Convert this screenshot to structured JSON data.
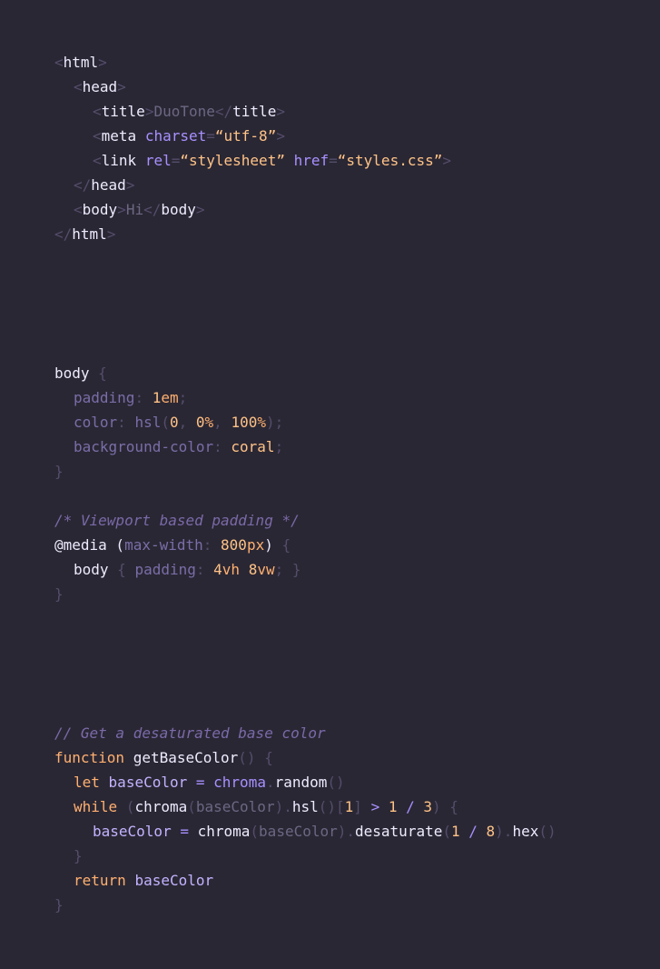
{
  "theme": {
    "background": "#2a2734",
    "colors": {
      "punct": "#544d6b",
      "tag": "#eeebff",
      "attr": "#a890ff",
      "string": "#ffc387",
      "text": "#6c6783",
      "prop": "#7a6ea8",
      "value": "#ffbf87",
      "comment": "#7a6aa8",
      "keyword": "#ffb070",
      "ident": "#eeebff",
      "var": "#c3b3ff"
    }
  },
  "code": {
    "html": [
      {
        "indent": 0,
        "segments": [
          {
            "t": "<",
            "c": "punct"
          },
          {
            "t": "html",
            "c": "tag"
          },
          {
            "t": ">",
            "c": "punct"
          }
        ]
      },
      {
        "indent": 1,
        "segments": [
          {
            "t": "<",
            "c": "punct"
          },
          {
            "t": "head",
            "c": "tag"
          },
          {
            "t": ">",
            "c": "punct"
          }
        ]
      },
      {
        "indent": 2,
        "segments": [
          {
            "t": "<",
            "c": "punct"
          },
          {
            "t": "title",
            "c": "tag"
          },
          {
            "t": ">",
            "c": "punct"
          },
          {
            "t": "DuoTone",
            "c": "text"
          },
          {
            "t": "</",
            "c": "punct"
          },
          {
            "t": "title",
            "c": "tag"
          },
          {
            "t": ">",
            "c": "punct"
          }
        ]
      },
      {
        "indent": 2,
        "segments": [
          {
            "t": "<",
            "c": "punct"
          },
          {
            "t": "meta",
            "c": "tag"
          },
          {
            "t": " ",
            "c": "punct"
          },
          {
            "t": "charset",
            "c": "attr"
          },
          {
            "t": "=",
            "c": "punct"
          },
          {
            "t": "“utf-8”",
            "c": "string"
          },
          {
            "t": ">",
            "c": "punct"
          }
        ]
      },
      {
        "indent": 2,
        "segments": [
          {
            "t": "<",
            "c": "punct"
          },
          {
            "t": "link",
            "c": "tag"
          },
          {
            "t": " ",
            "c": "punct"
          },
          {
            "t": "rel",
            "c": "attr"
          },
          {
            "t": "=",
            "c": "punct"
          },
          {
            "t": "“stylesheet”",
            "c": "string"
          },
          {
            "t": " ",
            "c": "punct"
          },
          {
            "t": "href",
            "c": "attr"
          },
          {
            "t": "=",
            "c": "punct"
          },
          {
            "t": "“styles.css”",
            "c": "string"
          },
          {
            "t": ">",
            "c": "punct"
          }
        ]
      },
      {
        "indent": 1,
        "segments": [
          {
            "t": "</",
            "c": "punct"
          },
          {
            "t": "head",
            "c": "tag"
          },
          {
            "t": ">",
            "c": "punct"
          }
        ]
      },
      {
        "indent": 1,
        "segments": [
          {
            "t": "<",
            "c": "punct"
          },
          {
            "t": "body",
            "c": "tag"
          },
          {
            "t": ">",
            "c": "punct"
          },
          {
            "t": "Hi",
            "c": "text"
          },
          {
            "t": "</",
            "c": "punct"
          },
          {
            "t": "body",
            "c": "tag"
          },
          {
            "t": ">",
            "c": "punct"
          }
        ]
      },
      {
        "indent": 0,
        "segments": [
          {
            "t": "</",
            "c": "punct"
          },
          {
            "t": "html",
            "c": "tag"
          },
          {
            "t": ">",
            "c": "punct"
          }
        ]
      }
    ],
    "css": [
      {
        "indent": 0,
        "segments": [
          {
            "t": "body",
            "c": "tag"
          },
          {
            "t": " {",
            "c": "punct"
          }
        ]
      },
      {
        "indent": 1,
        "segments": [
          {
            "t": "padding",
            "c": "prop"
          },
          {
            "t": ": ",
            "c": "punct"
          },
          {
            "t": "1",
            "c": "string"
          },
          {
            "t": "em",
            "c": "keyword"
          },
          {
            "t": ";",
            "c": "punct"
          }
        ]
      },
      {
        "indent": 1,
        "segments": [
          {
            "t": "color",
            "c": "prop"
          },
          {
            "t": ": ",
            "c": "punct"
          },
          {
            "t": "hsl",
            "c": "prop"
          },
          {
            "t": "(",
            "c": "punct"
          },
          {
            "t": "0",
            "c": "string"
          },
          {
            "t": ", ",
            "c": "punct"
          },
          {
            "t": "0",
            "c": "string"
          },
          {
            "t": "%",
            "c": "keyword"
          },
          {
            "t": ", ",
            "c": "punct"
          },
          {
            "t": "100",
            "c": "string"
          },
          {
            "t": "%",
            "c": "keyword"
          },
          {
            "t": ");",
            "c": "punct"
          }
        ]
      },
      {
        "indent": 1,
        "segments": [
          {
            "t": "background-color",
            "c": "prop"
          },
          {
            "t": ": ",
            "c": "punct"
          },
          {
            "t": "coral",
            "c": "string"
          },
          {
            "t": ";",
            "c": "punct"
          }
        ]
      },
      {
        "indent": 0,
        "segments": [
          {
            "t": "}",
            "c": "punct"
          }
        ]
      },
      {
        "indent": 0,
        "segments": []
      },
      {
        "indent": 0,
        "segments": [
          {
            "t": "/* Viewport based padding */",
            "c": "comment",
            "italic": true
          }
        ]
      },
      {
        "indent": 0,
        "segments": [
          {
            "t": "@media",
            "c": "tag"
          },
          {
            "t": " (",
            "c": "tag"
          },
          {
            "t": "max-width",
            "c": "prop"
          },
          {
            "t": ": ",
            "c": "punct"
          },
          {
            "t": "800",
            "c": "string"
          },
          {
            "t": "px",
            "c": "keyword"
          },
          {
            "t": ")",
            "c": "tag"
          },
          {
            "t": " {",
            "c": "punct"
          }
        ]
      },
      {
        "indent": 1,
        "segments": [
          {
            "t": "body",
            "c": "tag"
          },
          {
            "t": " { ",
            "c": "punct"
          },
          {
            "t": "padding",
            "c": "prop"
          },
          {
            "t": ": ",
            "c": "punct"
          },
          {
            "t": "4",
            "c": "string"
          },
          {
            "t": "vh",
            "c": "keyword"
          },
          {
            "t": " ",
            "c": "punct"
          },
          {
            "t": "8",
            "c": "string"
          },
          {
            "t": "vw",
            "c": "keyword"
          },
          {
            "t": "; }",
            "c": "punct"
          }
        ]
      },
      {
        "indent": 0,
        "segments": [
          {
            "t": "}",
            "c": "punct"
          }
        ]
      }
    ],
    "js": [
      {
        "indent": 0,
        "segments": [
          {
            "t": "// Get a desaturated base color",
            "c": "comment",
            "italic": true
          }
        ]
      },
      {
        "indent": 0,
        "segments": [
          {
            "t": "function",
            "c": "keyword"
          },
          {
            "t": " ",
            "c": "punct"
          },
          {
            "t": "getBaseColor",
            "c": "ident"
          },
          {
            "t": "() {",
            "c": "punct"
          }
        ]
      },
      {
        "indent": 1,
        "segments": [
          {
            "t": "let",
            "c": "keyword"
          },
          {
            "t": " ",
            "c": "punct"
          },
          {
            "t": "baseColor",
            "c": "var"
          },
          {
            "t": " = ",
            "c": "attr"
          },
          {
            "t": "chroma",
            "c": "attr"
          },
          {
            "t": ".",
            "c": "punct"
          },
          {
            "t": "random",
            "c": "ident"
          },
          {
            "t": "()",
            "c": "punct"
          }
        ]
      },
      {
        "indent": 1,
        "segments": [
          {
            "t": "while",
            "c": "keyword"
          },
          {
            "t": " (",
            "c": "punct"
          },
          {
            "t": "chroma",
            "c": "ident"
          },
          {
            "t": "(",
            "c": "punct"
          },
          {
            "t": "baseColor",
            "c": "text"
          },
          {
            "t": ").",
            "c": "punct"
          },
          {
            "t": "hsl",
            "c": "ident"
          },
          {
            "t": "()[",
            "c": "punct"
          },
          {
            "t": "1",
            "c": "string"
          },
          {
            "t": "] ",
            "c": "punct"
          },
          {
            "t": ">",
            "c": "attr"
          },
          {
            "t": " ",
            "c": "punct"
          },
          {
            "t": "1",
            "c": "string"
          },
          {
            "t": " / ",
            "c": "attr"
          },
          {
            "t": "3",
            "c": "string"
          },
          {
            "t": ") {",
            "c": "punct"
          }
        ]
      },
      {
        "indent": 2,
        "segments": [
          {
            "t": "baseColor",
            "c": "var"
          },
          {
            "t": " = ",
            "c": "attr"
          },
          {
            "t": "chroma",
            "c": "ident"
          },
          {
            "t": "(",
            "c": "punct"
          },
          {
            "t": "baseColor",
            "c": "text"
          },
          {
            "t": ").",
            "c": "punct"
          },
          {
            "t": "desaturate",
            "c": "ident"
          },
          {
            "t": "(",
            "c": "punct"
          },
          {
            "t": "1",
            "c": "string"
          },
          {
            "t": " / ",
            "c": "attr"
          },
          {
            "t": "8",
            "c": "string"
          },
          {
            "t": ").",
            "c": "punct"
          },
          {
            "t": "hex",
            "c": "ident"
          },
          {
            "t": "()",
            "c": "punct"
          }
        ]
      },
      {
        "indent": 1,
        "segments": [
          {
            "t": "}",
            "c": "punct"
          }
        ]
      },
      {
        "indent": 1,
        "segments": [
          {
            "t": "return",
            "c": "keyword"
          },
          {
            "t": " ",
            "c": "punct"
          },
          {
            "t": "baseColor",
            "c": "var"
          }
        ]
      },
      {
        "indent": 0,
        "segments": [
          {
            "t": "}",
            "c": "punct"
          }
        ]
      }
    ]
  }
}
